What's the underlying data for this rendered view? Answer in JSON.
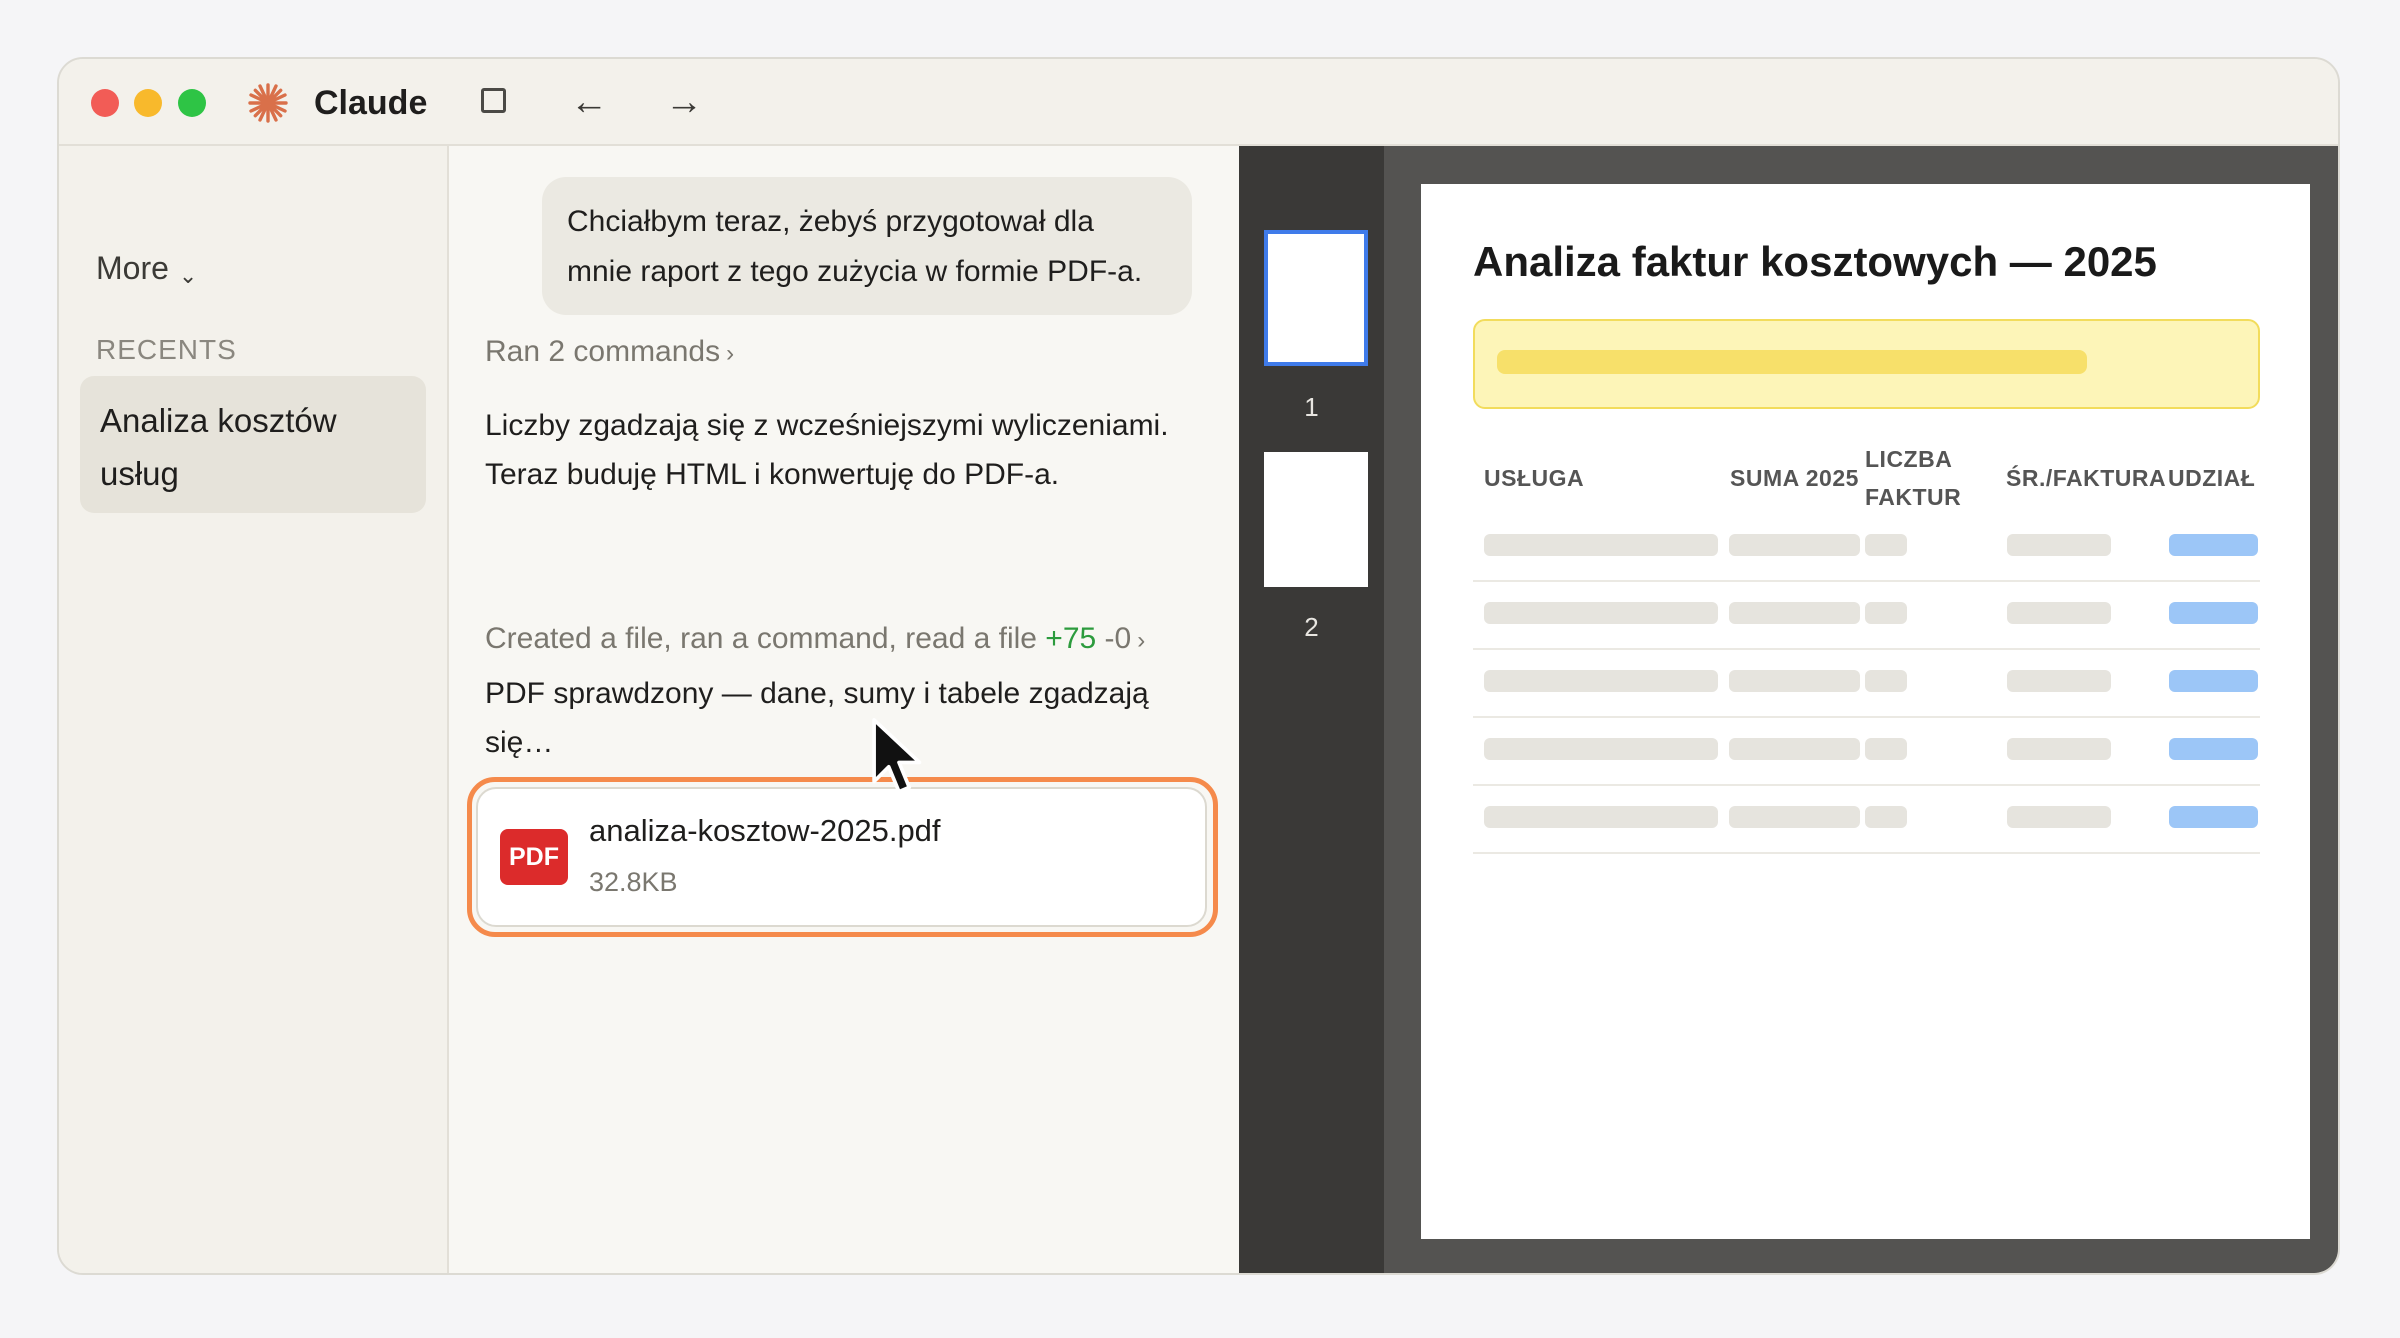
{
  "window": {
    "app_title": "Claude",
    "icons": [
      "claude-logo-icon",
      "sidebar-toggle-icon",
      "back-arrow-icon",
      "forward-arrow-icon"
    ],
    "nav_back": "←",
    "nav_forward": "→"
  },
  "sidebar": {
    "more_label": "More",
    "more_chevron": "⌄",
    "recents_label": "RECENTS",
    "recent_items": [
      {
        "line1": "Analiza kosztów",
        "line2": "usług"
      }
    ]
  },
  "chat": {
    "user_message": {
      "line1": "Chciałbym teraz, żebyś przygotował dla",
      "line2": "mnie raport z tego zużycia w formie PDF-a."
    },
    "activity1": {
      "label": "Ran 2 commands",
      "arrow": "›"
    },
    "assistant1": {
      "line1": "Liczby zgadzają się z wcześniejszymi wyliczeniami.",
      "line2": "Teraz buduję HTML i konwertuję do PDF-a."
    },
    "activity2": {
      "label": "Created a file, ran a command, read a file",
      "added": "+75",
      "removed": "-0",
      "arrow": "›"
    },
    "assistant2": {
      "line1": "PDF sprawdzony — dane, sumy i tabele zgadzają",
      "line2": "się…"
    },
    "file": {
      "badge": "PDF",
      "name": "analiza-kosztow-2025.pdf",
      "size": "32.8KB"
    }
  },
  "viewer": {
    "thumbnails": [
      {
        "num": "1",
        "selected": true
      },
      {
        "num": "2",
        "selected": false
      }
    ],
    "doc_title": "Analiza faktur kosztowych — 2025",
    "table_headers": {
      "usluga": "USŁUGA",
      "suma": "SUMA 2025",
      "liczba1": "LICZBA",
      "liczba2": "FAKTUR",
      "sr": "ŚR./FAKTURA",
      "udzial": "UDZIAŁ"
    },
    "colors": {
      "highlight": "#fdf5b8",
      "share_bar": "#9cc6f7",
      "selected_thumb": "#3f7bea"
    }
  }
}
